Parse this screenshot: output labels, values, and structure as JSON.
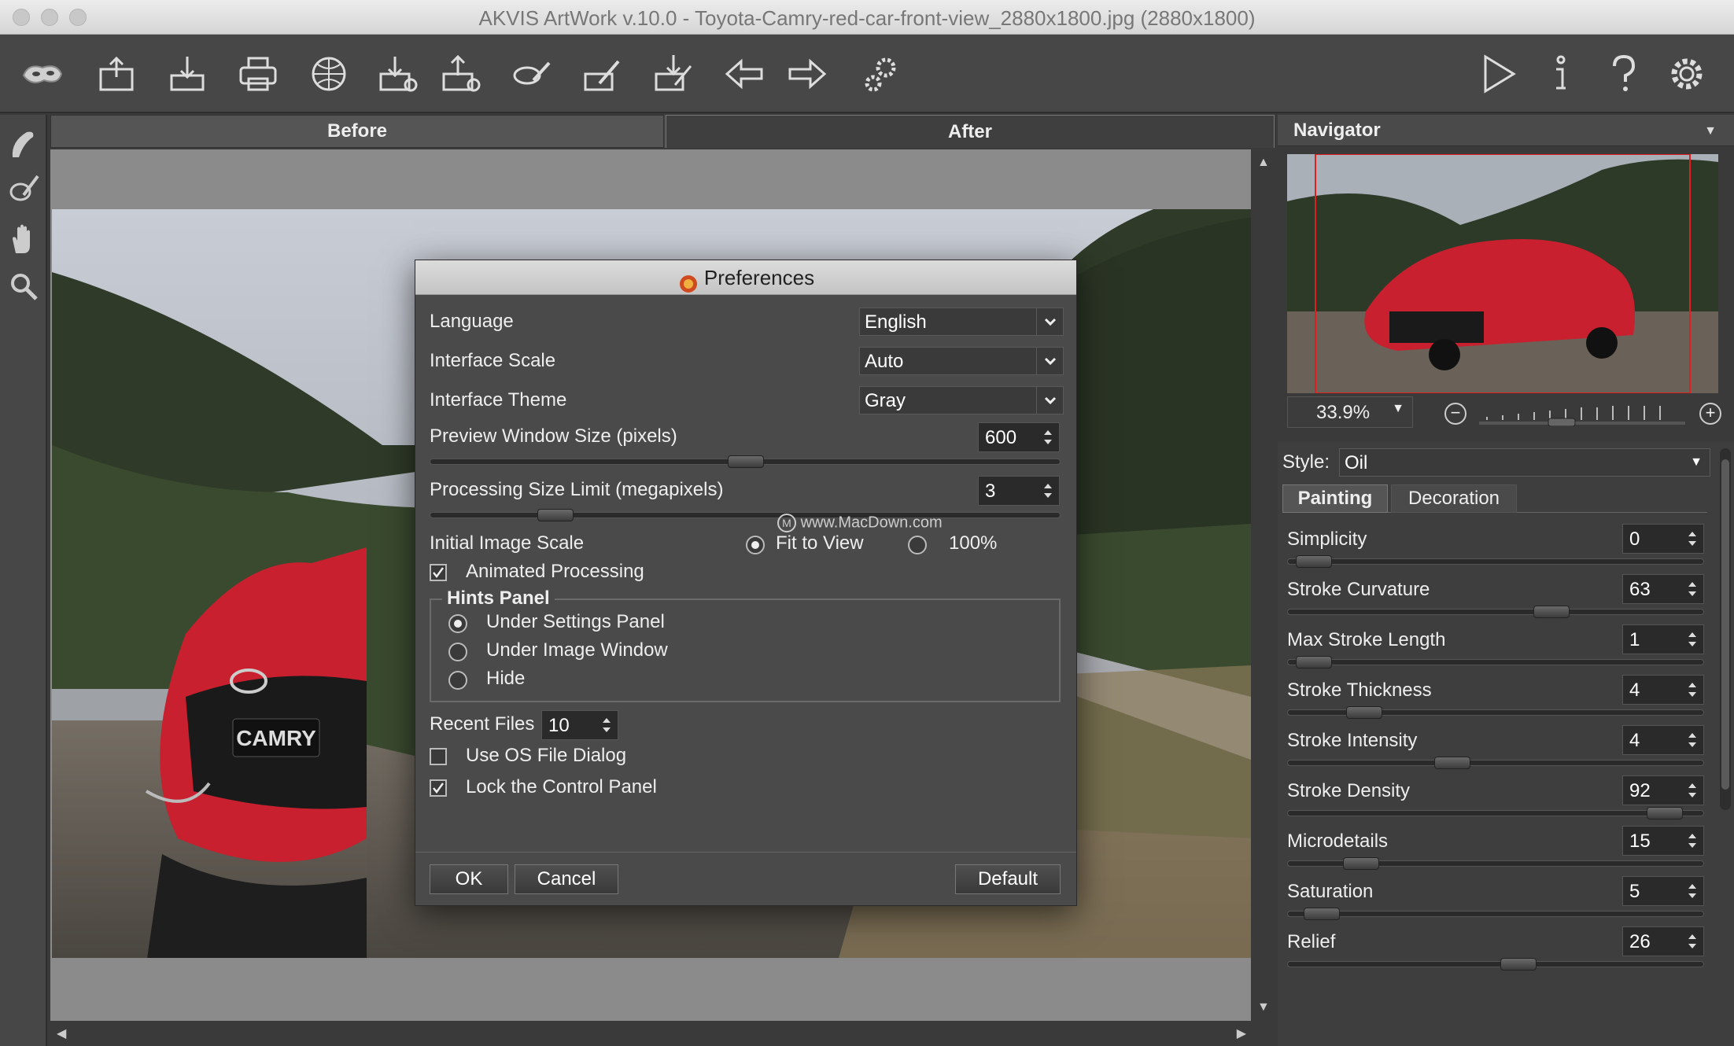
{
  "window": {
    "title": "AKVIS ArtWork v.10.0 - Toyota-Camry-red-car-front-view_2880x1800.jpg (2880x1800)"
  },
  "toolbar": {
    "icons": [
      "logo-mask-icon",
      "open-icon",
      "save-icon",
      "print-icon",
      "share-icon",
      "import-icon",
      "export-icon",
      "brush-strokes-icon",
      "load-preset-icon",
      "save-preset-icon",
      "undo-icon",
      "redo-icon",
      "batch-settings-icon",
      "run-icon",
      "info-icon",
      "help-icon",
      "preferences-icon"
    ]
  },
  "tools": [
    "brush-icon",
    "eraser-icon",
    "hand-icon",
    "zoom-icon"
  ],
  "view_tabs": {
    "before": "Before",
    "after": "After"
  },
  "photo": {
    "plate_text": "CAMRY"
  },
  "navigator": {
    "title": "Navigator",
    "zoom": "33.9%"
  },
  "settings": {
    "style_label": "Style:",
    "style_value": "Oil",
    "tabs": {
      "painting": "Painting",
      "decoration": "Decoration"
    },
    "params": [
      {
        "label": "Simplicity",
        "value": "0"
      },
      {
        "label": "Stroke Curvature",
        "value": "63"
      },
      {
        "label": "Max Stroke Length",
        "value": "1"
      },
      {
        "label": "Stroke Thickness",
        "value": "4"
      },
      {
        "label": "Stroke Intensity",
        "value": "4"
      },
      {
        "label": "Stroke Density",
        "value": "92"
      },
      {
        "label": "Microdetails",
        "value": "15"
      },
      {
        "label": "Saturation",
        "value": "5"
      },
      {
        "label": "Relief",
        "value": "26"
      }
    ]
  },
  "dialog": {
    "title": "Preferences",
    "language_label": "Language",
    "language_value": "English",
    "scale_label": "Interface Scale",
    "scale_value": "Auto",
    "theme_label": "Interface Theme",
    "theme_value": "Gray",
    "preview_label": "Preview Window Size (pixels)",
    "preview_value": "600",
    "proc_label": "Processing Size Limit (megapixels)",
    "proc_value": "3",
    "watermark": "www.MacDown.com",
    "initial_scale_label": "Initial Image Scale",
    "fit_to_view": "Fit to View",
    "hundred": "100%",
    "animated": "Animated Processing",
    "hints_title": "Hints Panel",
    "hints_under_settings": "Under Settings Panel",
    "hints_under_image": "Under Image Window",
    "hints_hide": "Hide",
    "recent_label": "Recent Files",
    "recent_value": "10",
    "os_dialog": "Use OS File Dialog",
    "lock_panel": "Lock the Control Panel",
    "ok": "OK",
    "cancel": "Cancel",
    "default": "Default"
  }
}
